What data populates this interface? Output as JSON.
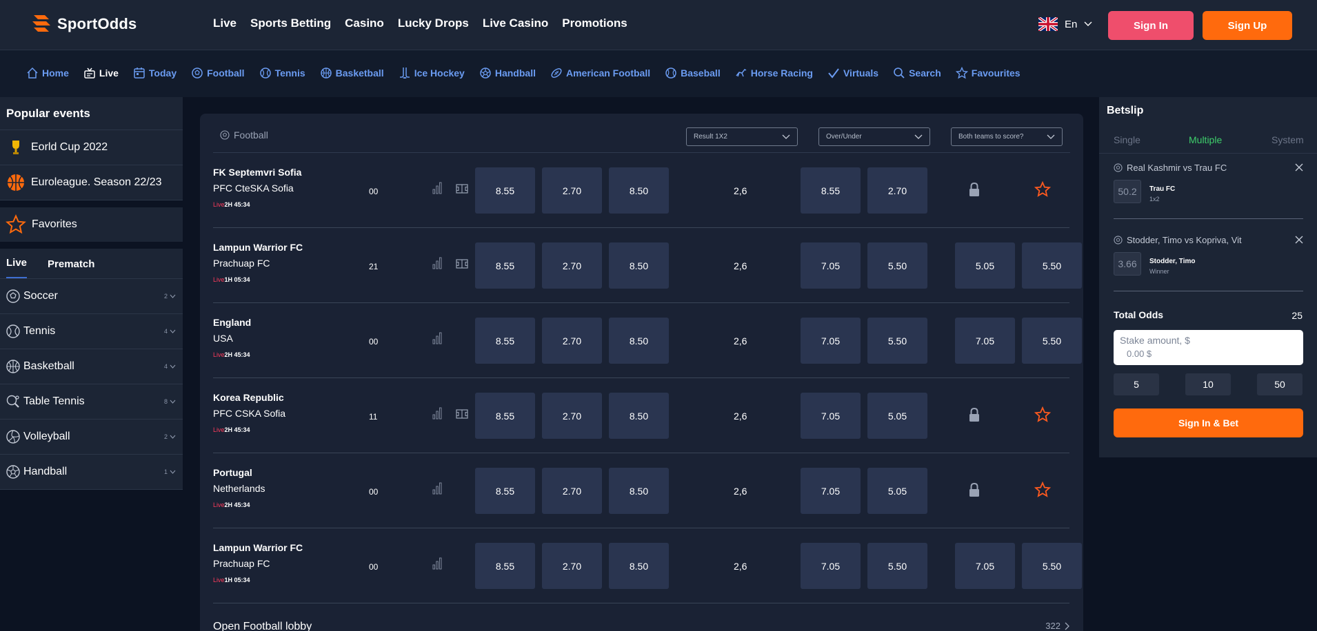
{
  "brand": {
    "name": "SportOdds"
  },
  "header": {
    "nav": [
      "Live",
      "Sports Betting",
      "Casino",
      "Lucky Drops",
      "Live Casino",
      "Promotions"
    ],
    "lang": "En",
    "sign_in": "Sign In",
    "sign_up": "Sign Up"
  },
  "sports_nav": [
    {
      "label": "Home",
      "icon": "home-icon"
    },
    {
      "label": "Live",
      "icon": "live-icon"
    },
    {
      "label": "Today",
      "icon": "calendar-icon"
    },
    {
      "label": "Football",
      "icon": "football-icon"
    },
    {
      "label": "Tennis",
      "icon": "tennis-icon"
    },
    {
      "label": "Basketball",
      "icon": "basketball-icon"
    },
    {
      "label": "Ice Hockey",
      "icon": "ice-hockey-icon"
    },
    {
      "label": "Handball",
      "icon": "handball-icon"
    },
    {
      "label": "American Football",
      "icon": "american-football-icon"
    },
    {
      "label": "Baseball",
      "icon": "baseball-icon"
    },
    {
      "label": "Horse Racing",
      "icon": "horse-racing-icon"
    },
    {
      "label": "Virtuals",
      "icon": "virtuals-icon"
    },
    {
      "label": "Search",
      "icon": "search-icon"
    },
    {
      "label": "Favourites",
      "icon": "star-icon"
    }
  ],
  "sidebar": {
    "popular_title": "Popular events",
    "popular": [
      "Eorld Cup 2022",
      "Euroleague. Season 22/23"
    ],
    "favorites": "Favorites",
    "tabs": [
      "Live",
      "Prematch"
    ],
    "sports": [
      {
        "name": "Soccer",
        "count": "2"
      },
      {
        "name": "Tennis",
        "count": "4"
      },
      {
        "name": "Basketball",
        "count": "4"
      },
      {
        "name": "Table Tennis",
        "count": "8"
      },
      {
        "name": "Volleyball",
        "count": "2"
      },
      {
        "name": "Handball",
        "count": "1"
      }
    ]
  },
  "center": {
    "sport": "Football",
    "markets": [
      "Result 1X2",
      "Over/Under",
      "Both teams to score?"
    ],
    "live_label": "Live",
    "matches": [
      {
        "team1": "FK Septemvri Sofia",
        "team2": "PFC CteSKA Sofia",
        "time": "2H 45:34",
        "score": "00",
        "field": true,
        "odds": [
          "8.55",
          "2.70",
          "8.50"
        ],
        "handicap": "2,6",
        "ou": [
          "8.55",
          "2.70"
        ],
        "btts": [],
        "locked": true
      },
      {
        "team1": "Lampun Warrior FC",
        "team2": "Prachuap FC",
        "time": "1H 05:34",
        "score": "21",
        "field": true,
        "odds": [
          "8.55",
          "2.70",
          "8.50"
        ],
        "handicap": "2,6",
        "ou": [
          "7.05",
          "5.50"
        ],
        "btts": [
          "5.05",
          "5.50"
        ],
        "locked": false
      },
      {
        "team1": "England",
        "team2": "USA",
        "time": "2H 45:34",
        "score": "00",
        "field": false,
        "odds": [
          "8.55",
          "2.70",
          "8.50"
        ],
        "handicap": "2,6",
        "ou": [
          "7.05",
          "5.50"
        ],
        "btts": [
          "7.05",
          "5.50"
        ],
        "locked": false
      },
      {
        "team1": "Korea Republic",
        "team2": "PFC CSKA Sofia",
        "time": "2H 45:34",
        "score": "11",
        "field": true,
        "odds": [
          "8.55",
          "2.70",
          "8.50"
        ],
        "handicap": "2,6",
        "ou": [
          "7.05",
          "5.05"
        ],
        "btts": [],
        "locked": true
      },
      {
        "team1": "Portugal",
        "team2": "Netherlands",
        "time": "2H 45:34",
        "score": "00",
        "field": false,
        "odds": [
          "8.55",
          "2.70",
          "8.50"
        ],
        "handicap": "2,6",
        "ou": [
          "7.05",
          "5.05"
        ],
        "btts": [],
        "locked": true
      },
      {
        "team1": "Lampun Warrior FC",
        "team2": "Prachuap FC",
        "time": "1H 05:34",
        "score": "00",
        "field": false,
        "odds": [
          "8.55",
          "2.70",
          "8.50"
        ],
        "handicap": "2,6",
        "ou": [
          "7.05",
          "5.50"
        ],
        "btts": [
          "7.05",
          "5.50"
        ],
        "locked": false
      }
    ],
    "lobby": "Open Football lobby",
    "lobby_count": "322"
  },
  "betslip": {
    "title": "Betslip",
    "tabs": [
      "Single",
      "Multiple",
      "System"
    ],
    "active_tab": "Multiple",
    "items": [
      {
        "event": "Real Kashmir vs Trau FC",
        "odd": "50.2",
        "selection": "Trau FC",
        "market": "1x2"
      },
      {
        "event": "Stodder, Timo vs Kopriva, Vit",
        "odd": "3.66",
        "selection": "Stodder, Timo",
        "market": "Winner"
      }
    ],
    "total_label": "Total Odds",
    "total_value": "25",
    "stake_placeholder": "Stake amount, $",
    "stake_value": "0.00 $",
    "quick": [
      "5",
      "10",
      "50"
    ],
    "submit": "Sign In & Bet"
  },
  "colors": {
    "accent_orange": "#ff6a0d",
    "signin_pink": "#ef4e6c",
    "link_blue": "#6b9cf2",
    "live_red": "#ff3b5c",
    "active_green": "#3ecf6b"
  }
}
